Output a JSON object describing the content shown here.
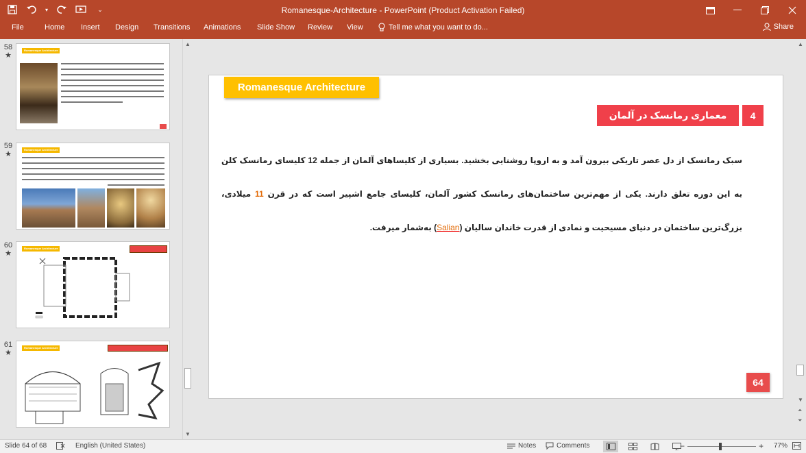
{
  "window": {
    "title": "Romanesque-Architecture - PowerPoint (Product Activation Failed)",
    "controls": [
      "restore-ribbon",
      "minimize",
      "maximize",
      "close"
    ]
  },
  "qat": {
    "icons": [
      "save-icon",
      "undo-icon",
      "undo-dropdown-icon",
      "redo-icon",
      "start-slideshow-icon",
      "customize-icon"
    ]
  },
  "ribbon": {
    "tabs": [
      "File",
      "Home",
      "Insert",
      "Design",
      "Transitions",
      "Animations",
      "Slide Show",
      "Review",
      "View"
    ],
    "tell_me": "Tell me what you want to do...",
    "share": "Share"
  },
  "thumbnails": [
    {
      "number": "58",
      "star": "★",
      "banner": "Romanesque Architecture"
    },
    {
      "number": "59",
      "star": "★",
      "banner": "Romanesque Architecture"
    },
    {
      "number": "60",
      "star": "★",
      "banner": "Romanesque Architecture"
    },
    {
      "number": "61",
      "star": "★",
      "banner": "Romanesque Architecture"
    }
  ],
  "slide": {
    "banner": "Romanesque Architecture",
    "heading": "معماری رمانسک در آلمان",
    "heading_number": "4",
    "body": {
      "p1": "سبک رمانسک از دل عصر تاریکی بیرون آمد و به اروپا روشنایی بخشید. بسیاری از کلیساهای آلمان از جمله 12 کلیسای رمانسک کلن به این دوره تعلق دارند. یکی از مهم‌ترین ساختمان‌های رمانسک کشور آلمان، کلیسای جامع اشپیر است که در قرن ",
      "highlight": "11",
      "p2": " میلادی، بزرگ‌ترین ساختمان در دنیای مسیحیت و نمادی از قدرت خاندان سالیان (",
      "underlined": "Salian",
      "p3": ") به‌شمار میرفت."
    },
    "page_number": "64"
  },
  "status": {
    "slide_info": "Slide 64 of 68",
    "language": "English (United States)",
    "notes": "Notes",
    "comments": "Comments",
    "zoom": "77%",
    "zoom_percent": 77
  }
}
